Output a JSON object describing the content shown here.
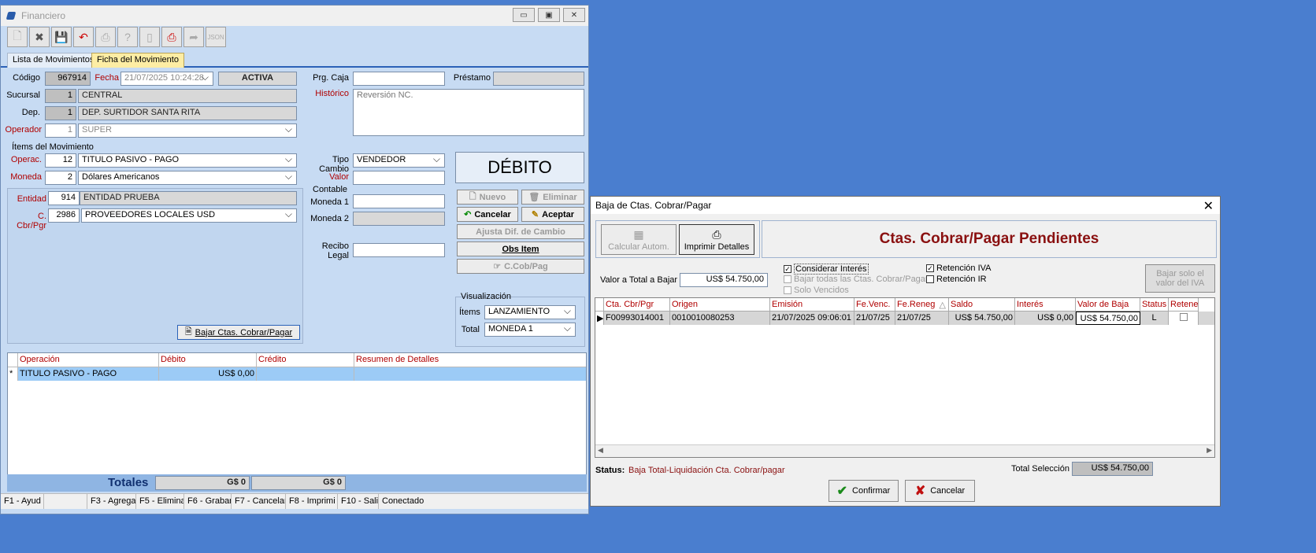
{
  "main": {
    "title": "Financiero",
    "tabs": [
      "Lista de Movimientos",
      "Ficha del Movimiento"
    ],
    "codigo_label": "Código",
    "codigo": "967914",
    "fecha_label": "Fecha",
    "fecha": "21/07/2025 10:24:28",
    "estado": "ACTIVA",
    "prg_caja_label": "Prg. Caja",
    "prestamo_label": "Préstamo",
    "sucursal_label": "Sucursal",
    "sucursal_num": "1",
    "sucursal": "CENTRAL",
    "historico_label": "Histórico",
    "historico": "Reversión NC.",
    "dep_label": "Dep.",
    "dep_num": "1",
    "dep": "DEP. SURTIDOR SANTA RITA",
    "operador_label": "Operador",
    "operador_num": "1",
    "operador": "SUPER",
    "items_label": "Ítems del Movimiento",
    "operac_label": "Operac.",
    "operac_num": "12",
    "operac": "TITULO PASIVO - PAGO",
    "tipo_cambio_label": "Tipo Cambio",
    "tipo_cambio": "VENDEDOR",
    "moneda_label": "Moneda",
    "moneda_num": "2",
    "moneda": "Dólares Americanos",
    "valor_label": "Valor",
    "debito": "DÉBITO",
    "entidad_label": "Entidad",
    "entidad_num": "914",
    "entidad": "ENTIDAD PRUEBA",
    "contable_label": "Contable",
    "moneda1_label": "Moneda 1",
    "moneda2_label": "Moneda 2",
    "ccbr_label": "C. Cbr/Pgr",
    "ccbr_num": "2986",
    "ccbr": "PROVEEDORES LOCALES USD",
    "nuevo": "Nuevo",
    "eliminar": "Eliminar",
    "cancelar": "Cancelar",
    "aceptar": "Aceptar",
    "ajusta": "Ajusta Dif. de Cambio",
    "obs_item": "Obs Item",
    "ccobpag": "C.Cob/Pag",
    "recibo_label": "Recibo Legal",
    "visualizacion_label": "Visualización",
    "items_vis_label": "Ítems",
    "items_vis": "LANZAMIENTO",
    "total_vis_label": "Total",
    "total_vis": "MONEDA 1",
    "bajar_btn": "Bajar Ctas. Cobrar/Pagar",
    "grid_headers": [
      "Operación",
      "Débito",
      "Crédito",
      "Resumen de Detalles"
    ],
    "grid_row": {
      "marker": "*",
      "operacion": "TITULO PASIVO - PAGO",
      "debito": "US$ 0,00",
      "credito": "",
      "resumen": ""
    },
    "totales_label": "Totales",
    "total1": "G$ 0",
    "total2": "G$ 0",
    "status": [
      "F1 - Ayud",
      "",
      "F3 - Agrega",
      "F5 - Elimina",
      "F6 - Grabar",
      "F7 - Cancelar",
      "F8 - Imprimi",
      "F10 - Salir",
      "Conectado"
    ]
  },
  "dialog": {
    "title": "Baja de Ctas. Cobrar/Pagar",
    "calc_btn": "Calcular Autom.",
    "print_btn": "Imprimir Detalles",
    "heading": "Ctas. Cobrar/Pagar Pendientes",
    "valor_label": "Valor a Total a Bajar",
    "valor": "US$ 54.750,00",
    "considerar_interes": "Considerar Interés",
    "bajar_todas": "Bajar todas las Ctas. Cobrar/Pagar",
    "solo_vencidos": "Solo Vencidos",
    "retencion_iva": "Retención IVA",
    "retencion_ir": "Retención IR",
    "bajar_iva_btn": "Bajar solo el valor del IVA",
    "headers": [
      "Cta. Cbr/Pgr",
      "Origen",
      "Emisión",
      "Fe.Venc.",
      "Fe.Reneg",
      "Saldo",
      "Interés",
      "Valor de Baja",
      "Status",
      "Retene"
    ],
    "row": [
      "F00993014001",
      "0010010080253",
      "21/07/2025 09:06:01",
      "21/07/25",
      "21/07/25",
      "US$ 54.750,00",
      "US$ 0,00",
      "US$ 54.750,00",
      "L",
      ""
    ],
    "status_label": "Status:",
    "status_text": "Baja Total-Liquidación Cta. Cobrar/pagar",
    "total_sel_label": "Total Selección",
    "total_sel": "US$ 54.750,00",
    "confirmar": "Confirmar",
    "cancelar": "Cancelar"
  }
}
